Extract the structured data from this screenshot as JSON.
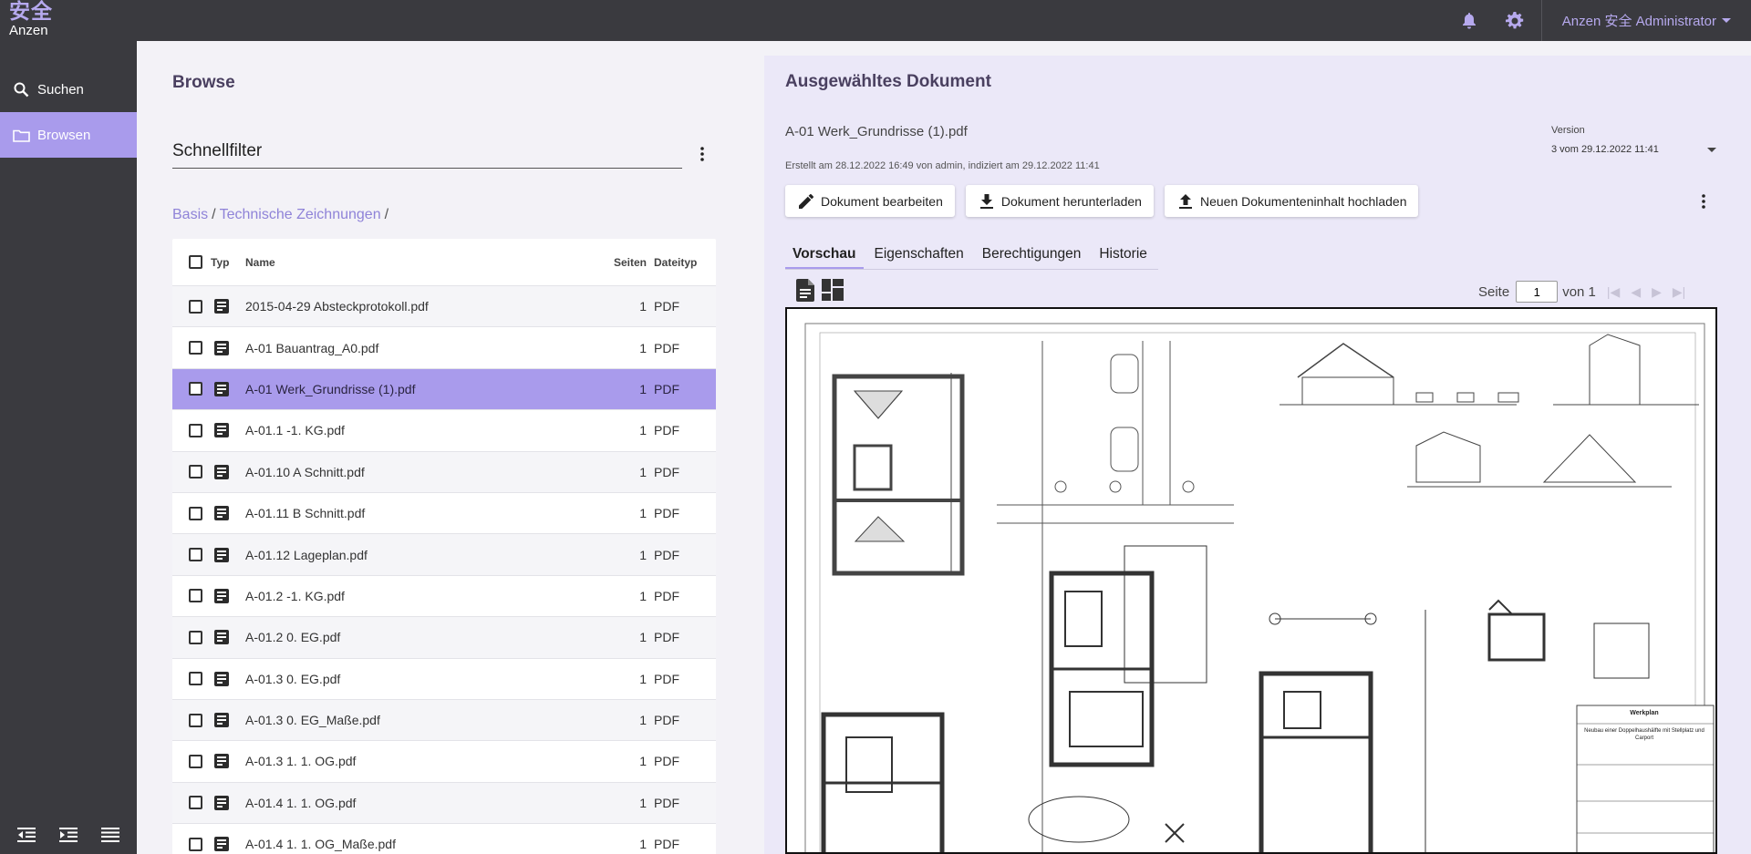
{
  "app": {
    "logo_kanji": "安全",
    "logo_text": "Anzen",
    "user_label": "Anzen 安全 Administrator"
  },
  "sidebar": {
    "items": [
      {
        "label": "Suchen",
        "icon": "search-icon"
      },
      {
        "label": "Browsen",
        "icon": "folder-icon"
      }
    ]
  },
  "browse": {
    "title": "Browse",
    "filter_value": "Schnellfilter",
    "breadcrumb": {
      "root": "Basis",
      "folder": "Technische Zeichnungen",
      "sep": "/"
    },
    "headers": {
      "typ": "Typ",
      "name": "Name",
      "pages": "Seiten",
      "filetype": "Dateityp"
    },
    "rows": [
      {
        "name": "2015-04-29 Absteckprotokoll.pdf",
        "pages": "1",
        "type": "PDF"
      },
      {
        "name": "A-01 Bauantrag_A0.pdf",
        "pages": "1",
        "type": "PDF"
      },
      {
        "name": "A-01 Werk_Grundrisse (1).pdf",
        "pages": "1",
        "type": "PDF"
      },
      {
        "name": "A-01.1 -1. KG.pdf",
        "pages": "1",
        "type": "PDF"
      },
      {
        "name": "A-01.10 A Schnitt.pdf",
        "pages": "1",
        "type": "PDF"
      },
      {
        "name": "A-01.11 B Schnitt.pdf",
        "pages": "1",
        "type": "PDF"
      },
      {
        "name": "A-01.12 Lageplan.pdf",
        "pages": "1",
        "type": "PDF"
      },
      {
        "name": "A-01.2 -1. KG.pdf",
        "pages": "1",
        "type": "PDF"
      },
      {
        "name": "A-01.2 0. EG.pdf",
        "pages": "1",
        "type": "PDF"
      },
      {
        "name": "A-01.3 0. EG.pdf",
        "pages": "1",
        "type": "PDF"
      },
      {
        "name": "A-01.3 0. EG_Maße.pdf",
        "pages": "1",
        "type": "PDF"
      },
      {
        "name": "A-01.3 1. 1. OG.pdf",
        "pages": "1",
        "type": "PDF"
      },
      {
        "name": "A-01.4 1. 1. OG.pdf",
        "pages": "1",
        "type": "PDF"
      },
      {
        "name": "A-01.4 1. 1. OG_Maße.pdf",
        "pages": "1",
        "type": "PDF"
      }
    ],
    "selected_index": 2
  },
  "detail": {
    "title": "Ausgewähltes Dokument",
    "doc_name": "A-01 Werk_Grundrisse (1).pdf",
    "meta": "Erstellt am 28.12.2022 16:49 von admin, indiziert am 29.12.2022 11:41",
    "version_label": "Version",
    "version_value": "3 vom 29.12.2022 11:41",
    "actions": {
      "edit": "Dokument bearbeiten",
      "download": "Dokument herunterladen",
      "upload": "Neuen Dokumenteninhalt hochladen"
    },
    "tabs": [
      "Vorschau",
      "Eigenschaften",
      "Berechtigungen",
      "Historie"
    ],
    "pager": {
      "label": "Seite",
      "page": "1",
      "of": "von 1"
    },
    "plan": {
      "title": "Werkplan",
      "subtitle": "Neubau einer Doppelhaushälfte mit Stellplatz und Carport"
    }
  },
  "colors": {
    "accent": "#a99bec",
    "dark": "#3a3a3f",
    "panel": "#ebe8f8"
  }
}
